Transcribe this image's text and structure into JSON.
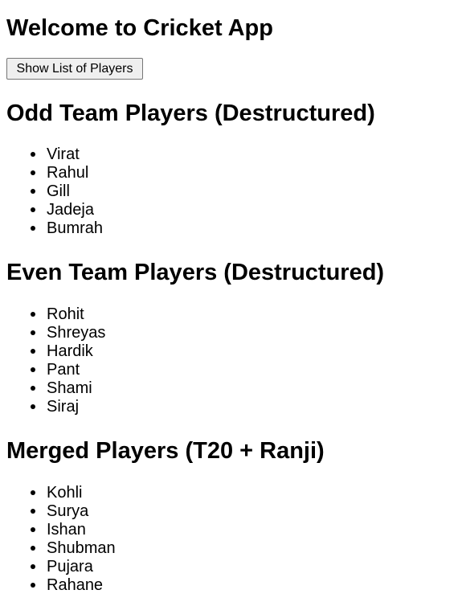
{
  "app": {
    "title": "Welcome to Cricket App",
    "show_button_label": "Show List of Players"
  },
  "odd_section": {
    "heading": "Odd Team Players (Destructured)",
    "players": [
      "Virat",
      "Rahul",
      "Gill",
      "Jadeja",
      "Bumrah"
    ]
  },
  "even_section": {
    "heading": "Even Team Players (Destructured)",
    "players": [
      "Rohit",
      "Shreyas",
      "Hardik",
      "Pant",
      "Shami",
      "Siraj"
    ]
  },
  "merged_section": {
    "heading": "Merged Players (T20 + Ranji)",
    "players": [
      "Kohli",
      "Surya",
      "Ishan",
      "Shubman",
      "Pujara",
      "Rahane"
    ]
  }
}
